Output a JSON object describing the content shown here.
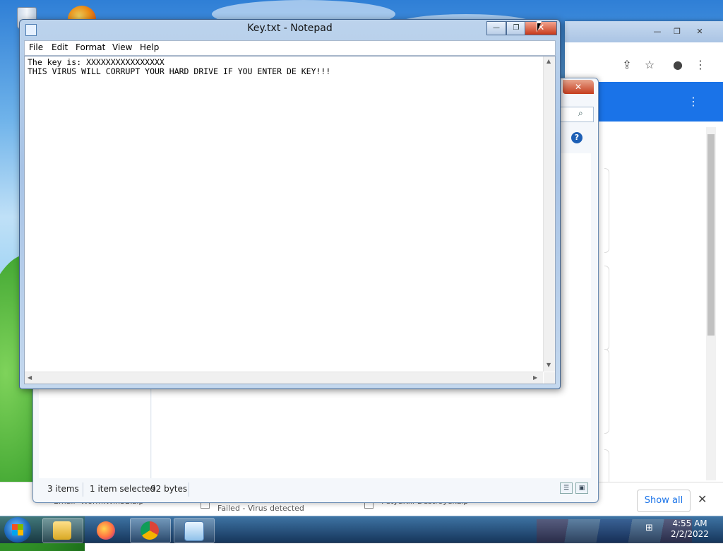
{
  "notepad": {
    "title": "Key.txt - Notepad",
    "menu": [
      "File",
      "Edit",
      "Format",
      "View",
      "Help"
    ],
    "content_line1": "The key is: XXXXXXXXXXXXXXXX",
    "content_line2": "THIS VIRUS WILL CORRUPT YOUR HARD DRIVE IF YOU ENTER DE KEY!!!"
  },
  "explorer": {
    "status_items": "3 items",
    "status_selected": "1 item selected",
    "status_size": "92 bytes"
  },
  "chrome": {
    "downloads": {
      "item1": "Email- Worm.Win32.zip",
      "item2_status": "Failed - Virus detected",
      "item3": "PetyaKill-Destroyer.zip",
      "show_all": "Show all"
    }
  },
  "taskbar": {
    "time": "4:55 AM",
    "date": "2/2/2022",
    "pinned": [
      "windows-explorer",
      "firefox",
      "chrome",
      "notepad"
    ]
  },
  "colors": {
    "accent": "#1a73e8",
    "close_red": "#c7391a",
    "taskbar": "#1f3a5c"
  }
}
